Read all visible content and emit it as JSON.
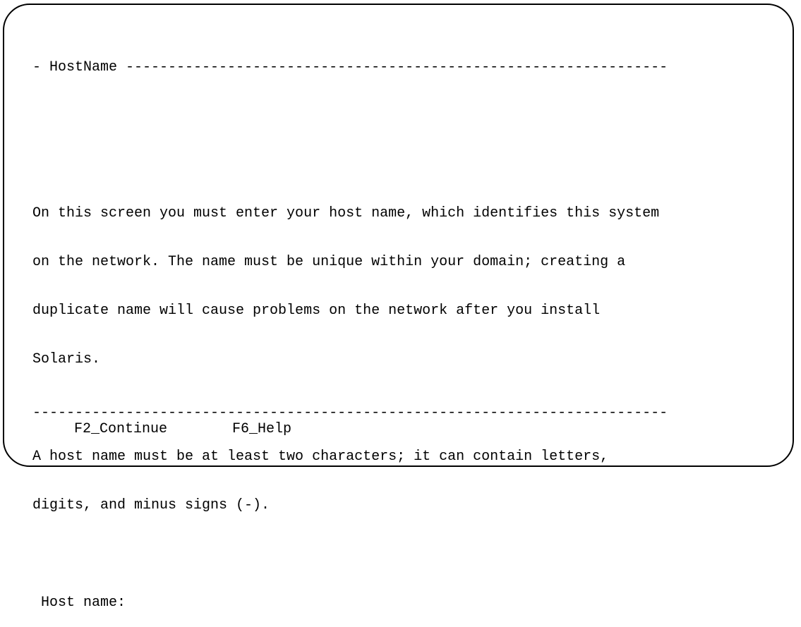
{
  "screen": {
    "header": "- HostName ----------------------------------------------------------------",
    "description_lines": [
      "On this screen you must enter your host name, which identifies this system",
      "on the network. The name must be unique within your domain; creating a",
      "duplicate name will cause problems on the network after you install",
      "Solaris."
    ],
    "rules_lines": [
      "A host name must be at least two characters; it can contain letters,",
      "digits, and minus signs (-)."
    ],
    "field_label": " Host name:",
    "separator": "---------------------------------------------------------------------------"
  },
  "footer": {
    "continue_key": "F2_Continue",
    "help_key": "F6_Help"
  }
}
